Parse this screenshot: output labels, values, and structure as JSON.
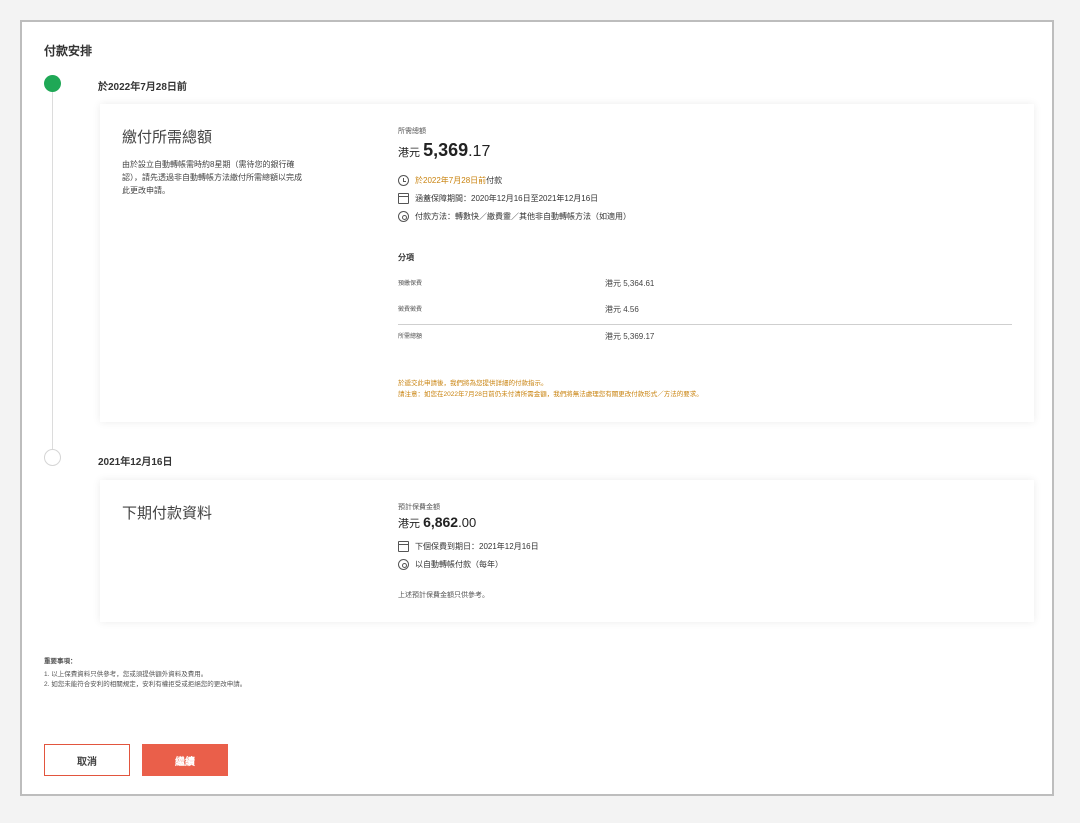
{
  "page_title": "付款安排",
  "colors": {
    "accent": "#ea5f4a",
    "success": "#1fa856",
    "highlight": "#c9830f"
  },
  "step1": {
    "date": "於2022年7月28日前",
    "card_title": "繳付所需總額",
    "description_lines": [
      "由於設立自動轉帳需時約8星期（需待您的銀行確",
      "認），請先透過非自動轉帳方法繳付所需總額以完成",
      "此更改申請。"
    ],
    "total_label": "所需總額",
    "currency": "港元",
    "total_int": "5,369",
    "total_dec": ".17",
    "due_prefix": "於",
    "due_date": "2022年7月28日前",
    "due_suffix": "付款",
    "period": "涵蓋保障期間：2020年12月16日至2021年12月16日",
    "method": "付款方法：轉數快／繳費靈／其他非自動轉帳方法（如適用）",
    "breakdown_title": "分項",
    "breakdown": [
      {
        "label": "預繳保費",
        "value": "港元 5,364.61"
      },
      {
        "label": "徵費徵費",
        "value": "港元 4.56"
      }
    ],
    "total_row": {
      "label": "所需總額",
      "value": "港元 5,369.17"
    },
    "warning_lines": [
      "於遞交此申請後，我們將為您提供詳細的付款指示。",
      "請注意：如您在2022年7月28日前仍未付清所需金額，我們將無法處理您有關更改付款形式／方法的要求。"
    ]
  },
  "step2": {
    "date": "2021年12月16日",
    "card_title": "下期付款資料",
    "premium_label": "預計保費金額",
    "currency": "港元",
    "premium_int": "6,862",
    "premium_dec": ".00",
    "due": "下個保費到期日：2021年12月16日",
    "method": "以自動轉帳付款（每年）",
    "note": "上述預計保費金額只供參考。"
  },
  "notes": {
    "title": "重要事項：",
    "items": [
      "1. 以上保費資料只供參考，您或須提供額外資料及費用。",
      "2. 如您未能符合安利的相關規定，安利有權拒受或拒絕您的更改申請。"
    ]
  },
  "buttons": {
    "cancel": "取消",
    "continue": "繼續"
  }
}
